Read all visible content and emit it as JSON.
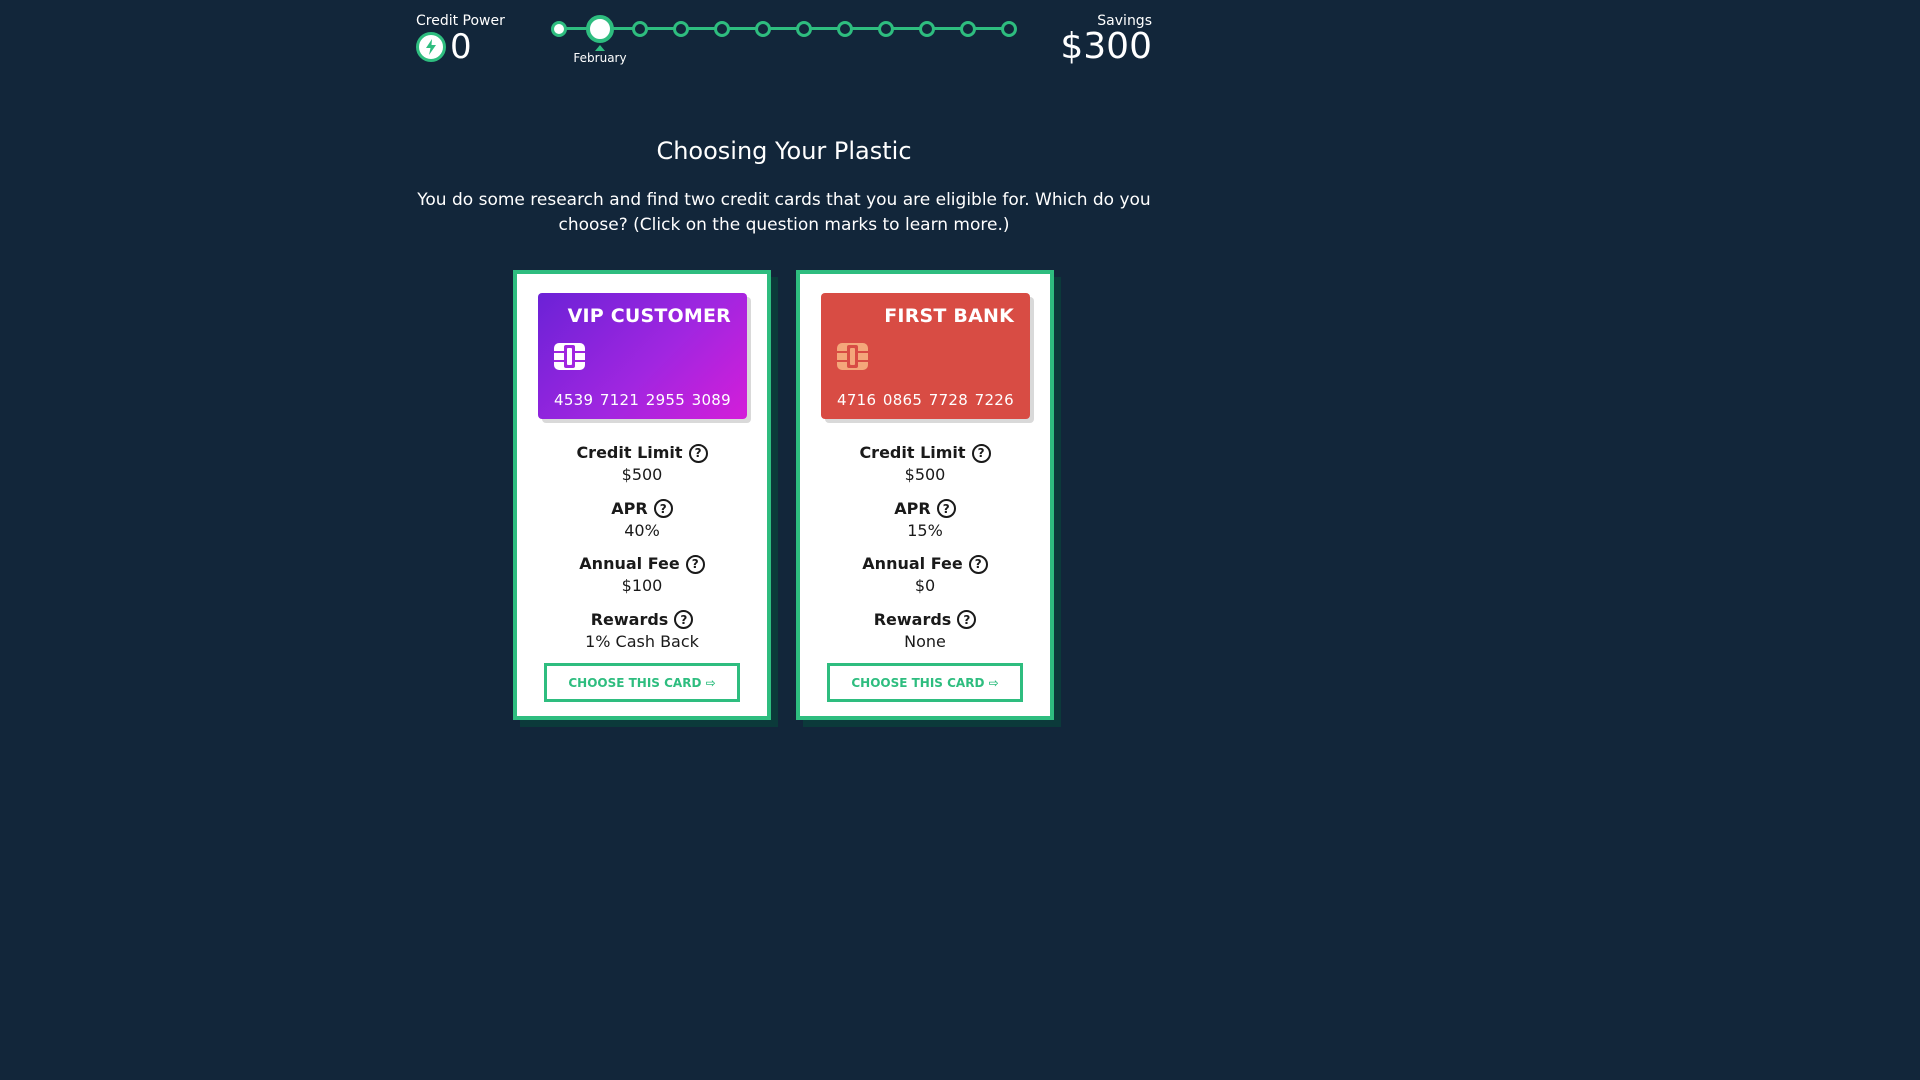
{
  "header": {
    "credit_power": {
      "label": "Credit Power",
      "value": "0",
      "icon": "lightning-bolt-icon"
    },
    "timeline": {
      "total_steps": 12,
      "current_step": 2,
      "current_month": "February"
    },
    "savings": {
      "label": "Savings",
      "value": "$300"
    }
  },
  "main": {
    "title": "Choosing Your Plastic",
    "description": "You do some research and find two credit cards that you are eligible for. Which do you choose? (Click on the question marks to learn more.)",
    "cards": [
      {
        "bank": "VIP CUSTOMER",
        "number_groups": [
          "4539",
          "7121",
          "2955",
          "3089"
        ],
        "credit_limit_label": "Credit Limit",
        "credit_limit": "$500",
        "apr_label": "APR",
        "apr": "40%",
        "annual_fee_label": "Annual Fee",
        "annual_fee": "$100",
        "rewards_label": "Rewards",
        "rewards": "1% Cash Back",
        "button_label": "CHOOSE THIS CARD ⇨",
        "colors": {
          "start": "#6b22d6",
          "end": "#d41ed9",
          "chip": "#ffffff"
        }
      },
      {
        "bank": "FIRST BANK",
        "number_groups": [
          "4716",
          "0865",
          "7728",
          "7226"
        ],
        "credit_limit_label": "Credit Limit",
        "credit_limit": "$500",
        "apr_label": "APR",
        "apr": "15%",
        "annual_fee_label": "Annual Fee",
        "annual_fee": "$0",
        "rewards_label": "Rewards",
        "rewards": "None",
        "button_label": "CHOOSE THIS CARD ⇨",
        "colors": {
          "start": "#d84c44",
          "end": "#d84c44",
          "chip": "#f4a77a"
        }
      }
    ],
    "help_icon_text": "?"
  },
  "colors": {
    "background": "#12263a",
    "accent": "#2ebd7f",
    "panel_shadow": "#0b3a3a"
  }
}
